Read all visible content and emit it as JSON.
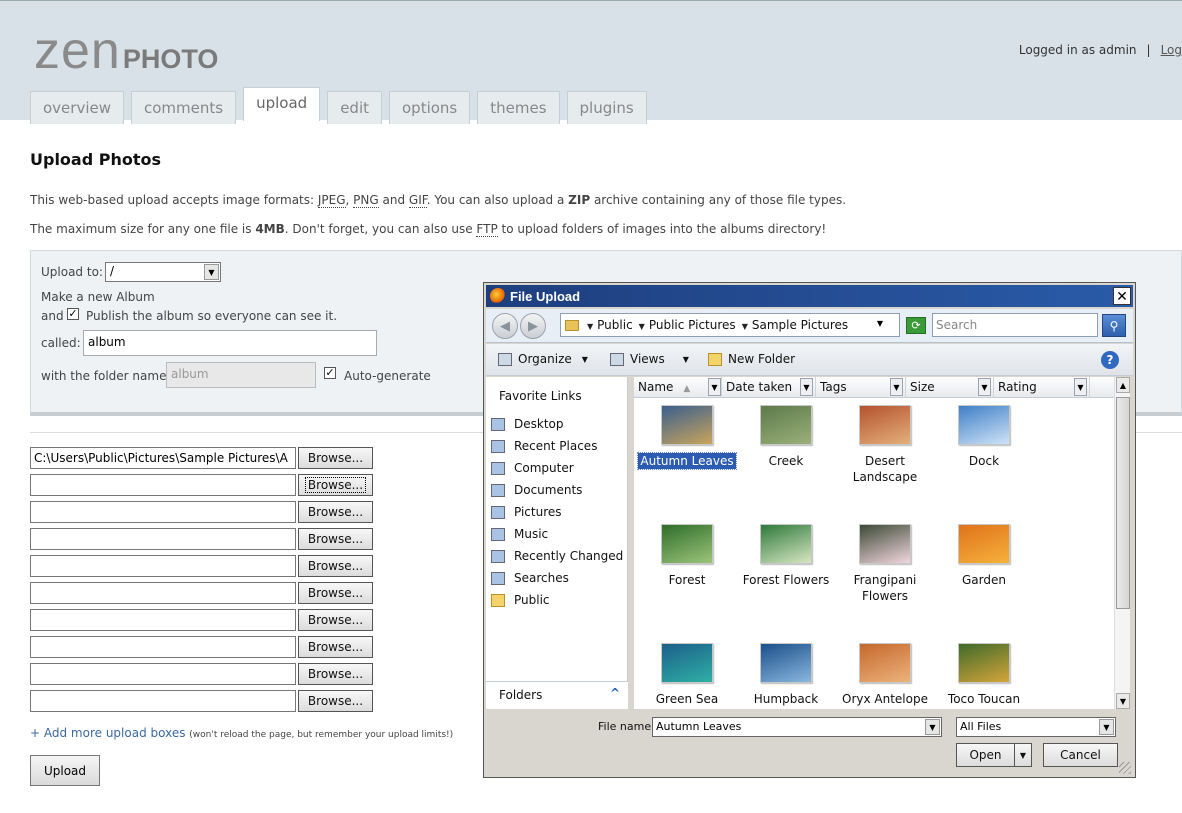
{
  "logo": {
    "zen": "zen",
    "photo": "PHOTO"
  },
  "header": {
    "logged_in": "Logged in as admin",
    "sep": "|",
    "logout": "Log"
  },
  "tabs": [
    {
      "label": "overview"
    },
    {
      "label": "comments"
    },
    {
      "label": "upload",
      "active": true
    },
    {
      "label": "edit"
    },
    {
      "label": "options"
    },
    {
      "label": "themes"
    },
    {
      "label": "plugins"
    }
  ],
  "main": {
    "title": "Upload Photos",
    "info1": {
      "a": "This web-based upload accepts image formats: ",
      "jpeg": "JPEG",
      "c1": ", ",
      "png": "PNG",
      "and": " and ",
      "gif": "GIF",
      "b": ". You can also upload a ",
      "zip": "ZIP",
      "c": " archive containing any of those file types."
    },
    "info2": {
      "a": "The maximum size for any one file is ",
      "size": "4MB",
      "b": ". Don't forget, you can also use ",
      "ftp": "FTP",
      "c": " to upload folders of images into the albums directory!"
    }
  },
  "album": {
    "upload_to_label": "Upload to:",
    "upload_to_value": "/",
    "new_album_label": "Make a new Album",
    "and_label": "and",
    "publish_checked": true,
    "publish_label": "Publish the album so everyone can see it.",
    "called_label": "called:",
    "called_value": "album",
    "folder_label": "with the folder name:",
    "folder_value": "album",
    "autogen_checked": true,
    "autogen_label": "Auto-generate"
  },
  "uploads": {
    "browse_label": "Browse...",
    "rows": [
      "C:\\Users\\Public\\Pictures\\Sample Pictures\\A",
      "",
      "",
      "",
      "",
      "",
      "",
      "",
      "",
      ""
    ],
    "add_more": "+ Add more upload boxes",
    "add_more_note": "(won't reload the page, but remember your upload limits!)",
    "upload_button": "Upload"
  },
  "dialog": {
    "title": "File Upload",
    "close": "✕",
    "breadcrumb": [
      "Public",
      "Public Pictures",
      "Sample Pictures"
    ],
    "search_placeholder": "Search",
    "toolbar": {
      "organize": "Organize",
      "views": "Views",
      "new_folder": "New Folder"
    },
    "favorites_title": "Favorite Links",
    "favorites": [
      "Desktop",
      "Recent Places",
      "Computer",
      "Documents",
      "Pictures",
      "Music",
      "Recently Changed",
      "Searches",
      "Public"
    ],
    "folders_label": "Folders",
    "columns": [
      "Name",
      "Date taken",
      "Tags",
      "Size",
      "Rating"
    ],
    "files": [
      {
        "name": "Autumn Leaves",
        "selected": true,
        "colors": [
          "#3a5f8e",
          "#c9a45c"
        ]
      },
      {
        "name": "Creek",
        "colors": [
          "#5d7a4a",
          "#9ab07a"
        ]
      },
      {
        "name": "Desert Landscape",
        "colors": [
          "#b5532e",
          "#e3b07a"
        ]
      },
      {
        "name": "Dock",
        "colors": [
          "#3f7fc7",
          "#cfe3f7"
        ]
      },
      {
        "name": "Forest",
        "colors": [
          "#2f6e2a",
          "#9cc47a"
        ]
      },
      {
        "name": "Forest Flowers",
        "colors": [
          "#2e7a3a",
          "#d8e6c4"
        ]
      },
      {
        "name": "Frangipani Flowers",
        "colors": [
          "#3d4a35",
          "#f2d7df"
        ]
      },
      {
        "name": "Garden",
        "colors": [
          "#e0721c",
          "#f5b23a"
        ]
      },
      {
        "name": "Green Sea",
        "colors": [
          "#1d5f8a",
          "#2eb0a4"
        ]
      },
      {
        "name": "Humpback",
        "colors": [
          "#1d4f8a",
          "#88b7de"
        ]
      },
      {
        "name": "Oryx Antelope",
        "colors": [
          "#c5682e",
          "#ecb37a"
        ]
      },
      {
        "name": "Toco Toucan",
        "colors": [
          "#3f6a2a",
          "#d5a53a"
        ]
      }
    ],
    "file_name_label": "File name:",
    "file_name_value": "Autumn Leaves",
    "file_type_value": "All Files",
    "open_label": "Open",
    "cancel_label": "Cancel",
    "help": "?"
  }
}
